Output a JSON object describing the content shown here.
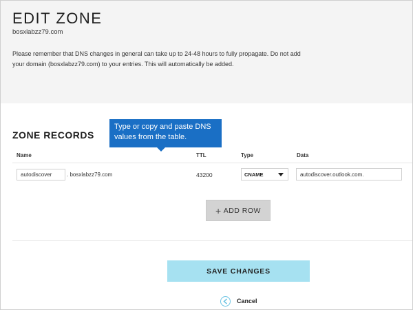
{
  "header": {
    "title": "EDIT ZONE",
    "domain": "bosxlabzz79.com",
    "notice": "Please remember that DNS changes in general can take up to 24-48 hours to fully propagate. Do not add your domain (bosxlabzz79.com) to your entries. This will automatically be added."
  },
  "records": {
    "section_title": "ZONE RECORDS",
    "callout": "Type or copy and paste DNS values from the table.",
    "columns": {
      "name": "Name",
      "ttl": "TTL",
      "type": "Type",
      "data": "Data"
    },
    "row": {
      "name_value": "autodiscover",
      "domain_suffix": ". bosxlabzz79.com",
      "ttl": "43200",
      "type_value": "CNAME",
      "data_value": "autodiscover.outlook.com."
    },
    "add_row_label": "ADD ROW"
  },
  "actions": {
    "save_label": "SAVE CHANGES",
    "cancel_label": "Cancel"
  },
  "icons": {
    "add": "plus-icon",
    "type_dropdown": "chevron-down-icon",
    "cancel": "chevron-left-circle-icon"
  },
  "colors": {
    "callout_bg": "#1a6fc5",
    "save_bg": "#a6e1f1",
    "add_row_bg": "#d3d3d3",
    "cancel_accent": "#6cc4e3",
    "header_bg": "#f4f4f4"
  }
}
